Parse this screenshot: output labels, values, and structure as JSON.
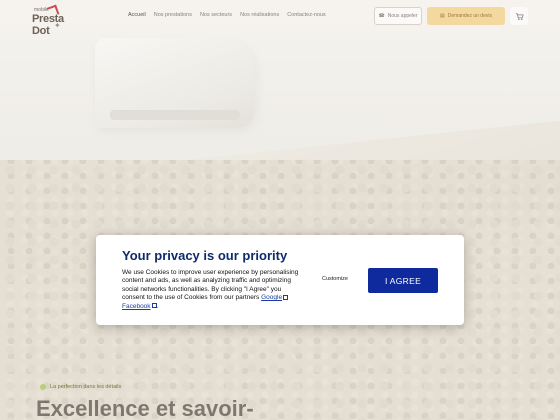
{
  "header": {
    "logo": {
      "small_text": "mobile",
      "name": "Presta Dot"
    },
    "nav": [
      {
        "label": "Accueil",
        "active": true
      },
      {
        "label": "Nos prestations",
        "active": false
      },
      {
        "label": "Nos secteurs",
        "active": false
      },
      {
        "label": "Nos réalisations",
        "active": false
      },
      {
        "label": "Contactez-nous",
        "active": false
      }
    ],
    "contact_button": "Nous appeler",
    "quote_button": "Demandez un devis",
    "cart_icon": "cart-icon"
  },
  "hero": {
    "tagline": "La perfection dans les détails",
    "headline": "Excellence et savoir-"
  },
  "consent": {
    "title": "Your privacy is our priority",
    "body_pre": "We use Cookies to improve user experience by personalising content and ads, as well as analyzing traffic and optimizing social networks functionalities. By clicking \"I Agree\" you consent to the use of Cookies from our partners ",
    "link_google": "Google",
    "link_facebook": "Facebook",
    "body_post": ".",
    "customize_label": "Customize",
    "agree_label": "I AGREE",
    "accent_color": "#0f2a9c"
  }
}
